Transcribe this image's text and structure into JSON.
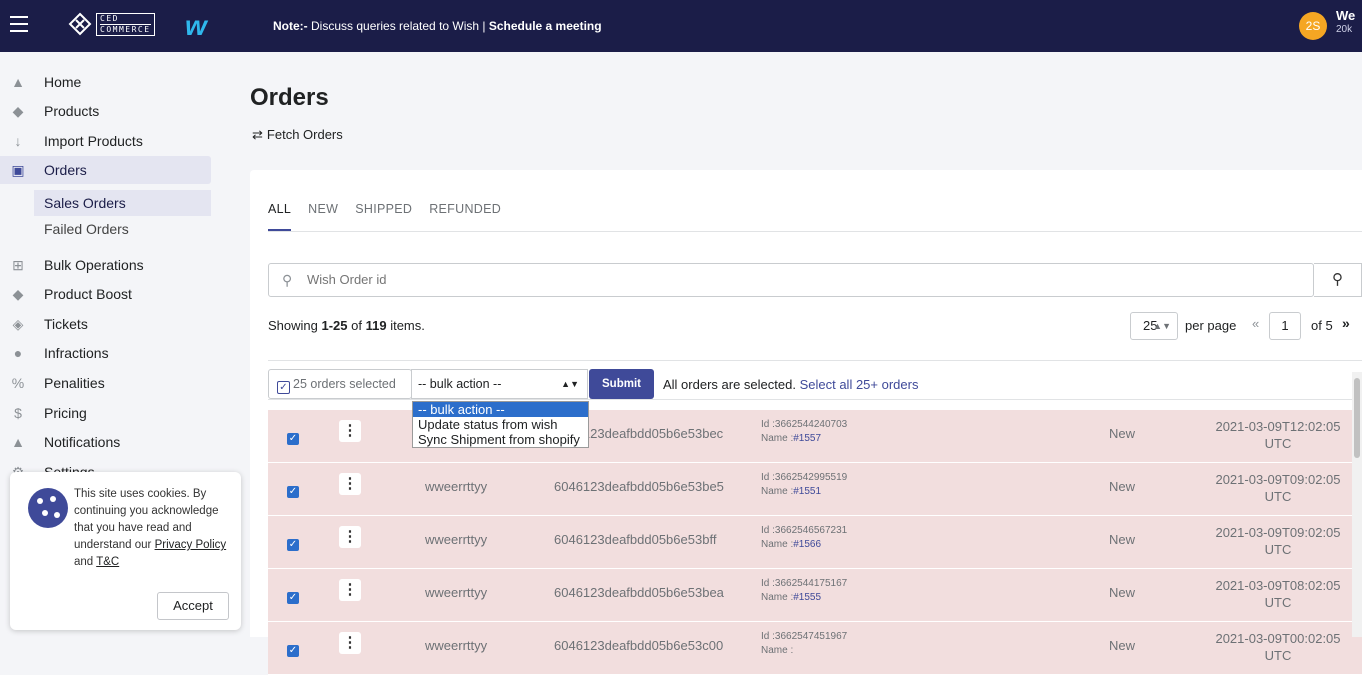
{
  "topbar": {
    "brand_line1": "CED",
    "brand_line2": "COMMERCE",
    "wish_logo": "w",
    "note_label": "Note:-",
    "note_text": " Discuss queries related to Wish | ",
    "note_link": "Schedule a meeting",
    "avatar": "2S",
    "user_name": "We",
    "user_sub": "20k"
  },
  "sidebar": {
    "items": [
      {
        "label": "Home",
        "icon": "home-icon"
      },
      {
        "label": "Products",
        "icon": "tag-icon"
      },
      {
        "label": "Import Products",
        "icon": "arrow-down-icon"
      },
      {
        "label": "Orders",
        "icon": "orders-icon"
      },
      {
        "label": "Bulk Operations",
        "icon": "grid-plus-icon"
      },
      {
        "label": "Product Boost",
        "icon": "tag-icon"
      },
      {
        "label": "Tickets",
        "icon": "ticket-icon"
      },
      {
        "label": "Infractions",
        "icon": "alert-icon"
      },
      {
        "label": "Penalities",
        "icon": "percent-icon"
      },
      {
        "label": "Pricing",
        "icon": "dollar-icon"
      },
      {
        "label": "Notifications",
        "icon": "bell-icon"
      },
      {
        "label": "Settings",
        "icon": "gear-icon"
      }
    ],
    "sub_items": [
      "Sales Orders",
      "Failed Orders"
    ]
  },
  "cookie": {
    "text": "This site uses cookies. By continuing you acknowledge that you have read and understand our ",
    "privacy_link": "Privacy Policy",
    "and": " and ",
    "tc_link": "T&C",
    "accept": "Accept"
  },
  "main": {
    "title": "Orders",
    "fetch": "Fetch Orders",
    "tabs": [
      "ALL",
      "NEW",
      "SHIPPED",
      "REFUNDED"
    ],
    "search_placeholder": "Wish Order id",
    "showing_prefix": "Showing ",
    "showing_range": "1-25",
    "showing_of": " of ",
    "showing_total": "119",
    "showing_suffix": " items.",
    "per_page_value": "25",
    "per_page_label": "per page",
    "page_prev": "«",
    "page_current": "1",
    "page_of": "of 5",
    "page_next": "»",
    "selected_count": "25 orders selected",
    "bulk_action": "-- bulk action --",
    "submit": "Submit",
    "all_selected": "All orders are selected. ",
    "select_all_link": "Select all 25+ orders",
    "dropdown_options": [
      "-- bulk action --",
      "Update status from wish",
      "Sync Shipment from shopify"
    ]
  },
  "rows": [
    {
      "name": "wweerrttyy",
      "order_id": "6046123deafbdd05b6e53bec",
      "id_label": "Id :",
      "id": "3662544240703",
      "name_label": "Name :",
      "order_name": "#1557",
      "status": "New",
      "date": "2021-03-09T12:02:05",
      "tz": "UTC"
    },
    {
      "name": "wweerrttyy",
      "order_id": "6046123deafbdd05b6e53be5",
      "id_label": "Id :",
      "id": "3662542995519",
      "name_label": "Name :",
      "order_name": "#1551",
      "status": "New",
      "date": "2021-03-09T09:02:05",
      "tz": "UTC"
    },
    {
      "name": "wweerrttyy",
      "order_id": "6046123deafbdd05b6e53bff",
      "id_label": "Id :",
      "id": "3662546567231",
      "name_label": "Name :",
      "order_name": "#1566",
      "status": "New",
      "date": "2021-03-09T09:02:05",
      "tz": "UTC"
    },
    {
      "name": "wweerrttyy",
      "order_id": "6046123deafbdd05b6e53bea",
      "id_label": "Id :",
      "id": "3662544175167",
      "name_label": "Name :",
      "order_name": "#1555",
      "status": "New",
      "date": "2021-03-09T08:02:05",
      "tz": "UTC"
    },
    {
      "name": "wweerrttyy",
      "order_id": "6046123deafbdd05b6e53c00",
      "id_label": "Id :",
      "id": "3662547451967",
      "name_label": "Name :",
      "order_name": "",
      "status": "New",
      "date": "2021-03-09T00:02:05",
      "tz": "UTC"
    }
  ],
  "colors": {
    "topbar": "#1b1d48",
    "accent": "#3f4a99",
    "row_selected": "#f2dede",
    "wish": "#2fb7ec",
    "avatar": "#f5a623"
  }
}
